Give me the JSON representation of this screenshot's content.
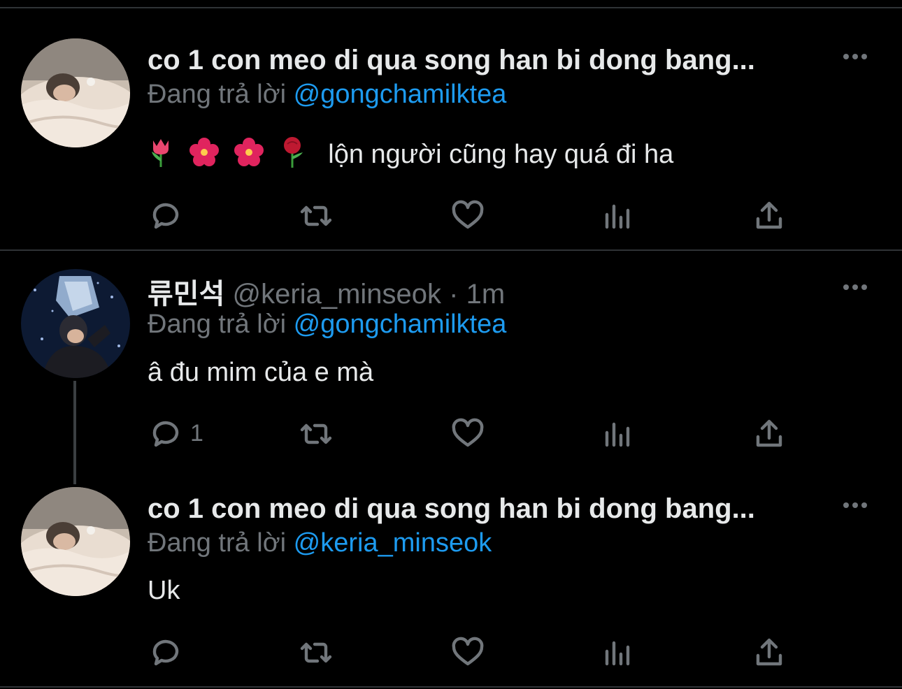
{
  "tweets": [
    {
      "name": "co 1 con meo di qua song han bi dong bang...",
      "handle": "",
      "time": "",
      "replying_label": "Đang trả lời",
      "replying_to": "@gongchamilktea",
      "text": "lộn người cũng hay quá đi ha",
      "emojis": [
        "tulip",
        "hibiscus",
        "hibiscus",
        "rose"
      ],
      "reply_count": "",
      "avatar": "cat-in-bed-avatar"
    },
    {
      "name": "류민석",
      "handle": "@keria_minseok",
      "time": "· 1m",
      "replying_label": "Đang trả lời",
      "replying_to": "@gongchamilktea",
      "text": "â đu mim của e mà",
      "reply_count": "1",
      "avatar": "trophy-avatar"
    },
    {
      "name": "co 1 con meo di qua song han bi dong bang...",
      "handle": "",
      "time": "",
      "replying_label": "Đang trả lời",
      "replying_to": "@keria_minseok",
      "text": "Uk",
      "reply_count": "",
      "avatar": "cat-in-bed-avatar"
    }
  ],
  "icons": [
    "reply-icon",
    "retweet-icon",
    "like-icon",
    "analytics-icon",
    "share-icon",
    "more-icon"
  ],
  "colors": {
    "background": "#000000",
    "text": "#e7e9ea",
    "muted": "#71767b",
    "mention": "#1d9bf0"
  }
}
